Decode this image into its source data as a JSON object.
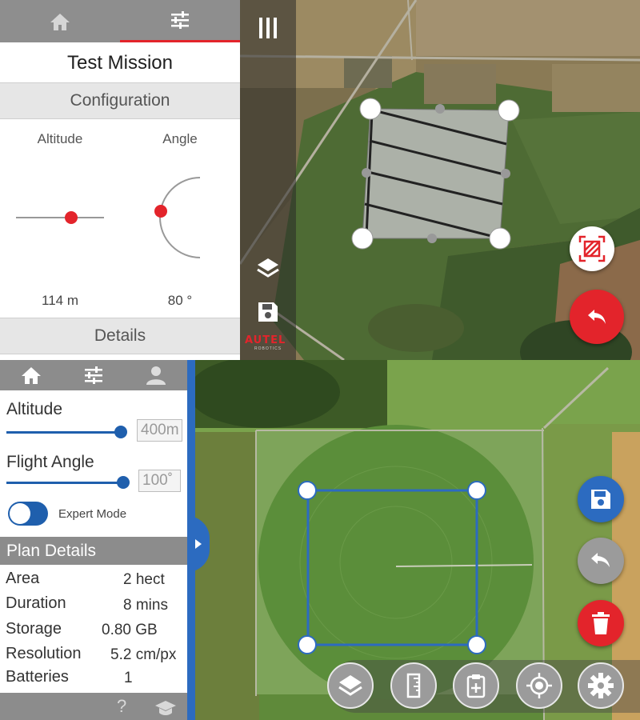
{
  "top_panel": {
    "mission_title": "Test Mission",
    "configuration_header": "Configuration",
    "altitude_label": "Altitude",
    "angle_label": "Angle",
    "altitude_value": "114 m",
    "angle_value": "80 °",
    "details_header": "Details",
    "brand": "AUTEL",
    "brand_sub": "ROBOTICS",
    "colors": {
      "accent": "#e3242b",
      "tab_bar": "#8e8e8e"
    },
    "icons": [
      "home-icon",
      "sliders-icon",
      "menu-icon",
      "layers-icon",
      "save-icon",
      "select-area-icon",
      "back-arrow-icon"
    ]
  },
  "bottom_panel": {
    "altitude_label": "Altitude",
    "altitude_value": "400m",
    "flight_angle_label": "Flight Angle",
    "flight_angle_value": "100˚",
    "expert_mode_label": "Expert Mode",
    "plan_details_header": "Plan Details",
    "plan_details": [
      {
        "label": "Area",
        "value": "2 hect"
      },
      {
        "label": "Duration",
        "value": "8 mins"
      },
      {
        "label": "Storage",
        "value": "0.80 GB"
      },
      {
        "label": "Resolution",
        "value": "5.2 cm/px"
      },
      {
        "label": "Batteries",
        "value": "1"
      }
    ],
    "help_glyph": "?",
    "colors": {
      "accent": "#2c6bc0",
      "save": "#2c6bc0",
      "delete": "#e3242b",
      "undo": "#9b9b9b"
    },
    "icons": [
      "home-icon",
      "sliders-icon",
      "user-icon",
      "help-icon",
      "graduation-cap-icon",
      "save-icon",
      "undo-icon",
      "trash-icon",
      "layers-icon",
      "ruler-icon",
      "clipboard-plus-icon",
      "target-icon",
      "gear-icon"
    ]
  }
}
